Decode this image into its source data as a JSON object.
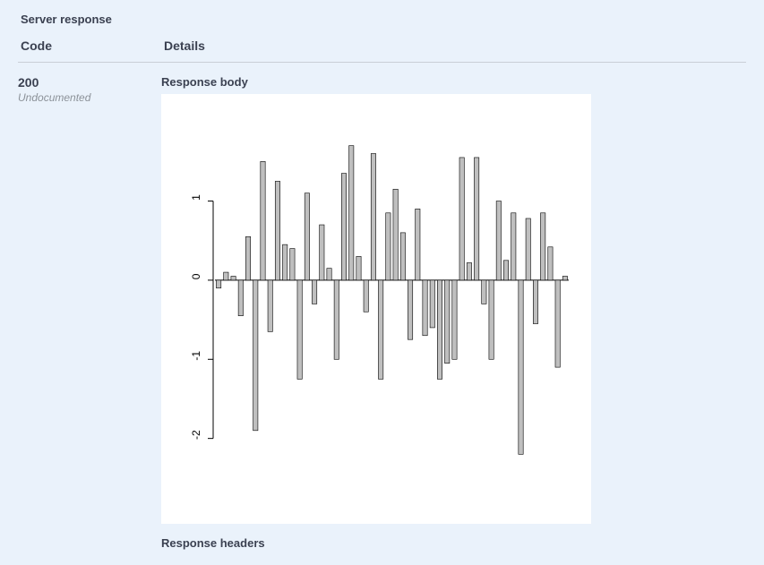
{
  "section_title": "Server response",
  "header": {
    "code_label": "Code",
    "details_label": "Details"
  },
  "response": {
    "code": "200",
    "code_note": "Undocumented",
    "body_label": "Response body",
    "headers_label": "Response headers"
  },
  "chart_data": {
    "type": "bar",
    "x_index": [
      1,
      2,
      3,
      4,
      5,
      6,
      7,
      8,
      9,
      10,
      11,
      12,
      13,
      14,
      15,
      16,
      17,
      18,
      19,
      20,
      21,
      22,
      23,
      24,
      25,
      26,
      27,
      28,
      29,
      30,
      31,
      32,
      33,
      34,
      35,
      36,
      37,
      38,
      39,
      40
    ],
    "values": [
      -0.1,
      0.1,
      0.05,
      -0.45,
      0.55,
      -1.9,
      1.5,
      -0.65,
      1.25,
      0.45,
      0.4,
      -1.25,
      1.1,
      -0.3,
      0.7,
      0.15,
      -1.0,
      1.35,
      1.7,
      0.3,
      -0.4,
      1.6,
      -1.25,
      0.85,
      1.15,
      0.6,
      -0.75,
      0.9,
      -0.7,
      -0.6,
      -1.25,
      -1.05,
      -1.0,
      1.55,
      0.22,
      1.55,
      -0.3,
      -1.0,
      1.0,
      0.25
    ],
    "values2": [
      0.85,
      -2.2,
      0.78,
      -0.55,
      0.85,
      0.42,
      -1.1,
      0.05
    ],
    "y_ticks": [
      -2,
      -1,
      0,
      1
    ],
    "ylim": [
      -2.4,
      1.9
    ],
    "title": "",
    "xlabel": "",
    "ylabel": ""
  }
}
